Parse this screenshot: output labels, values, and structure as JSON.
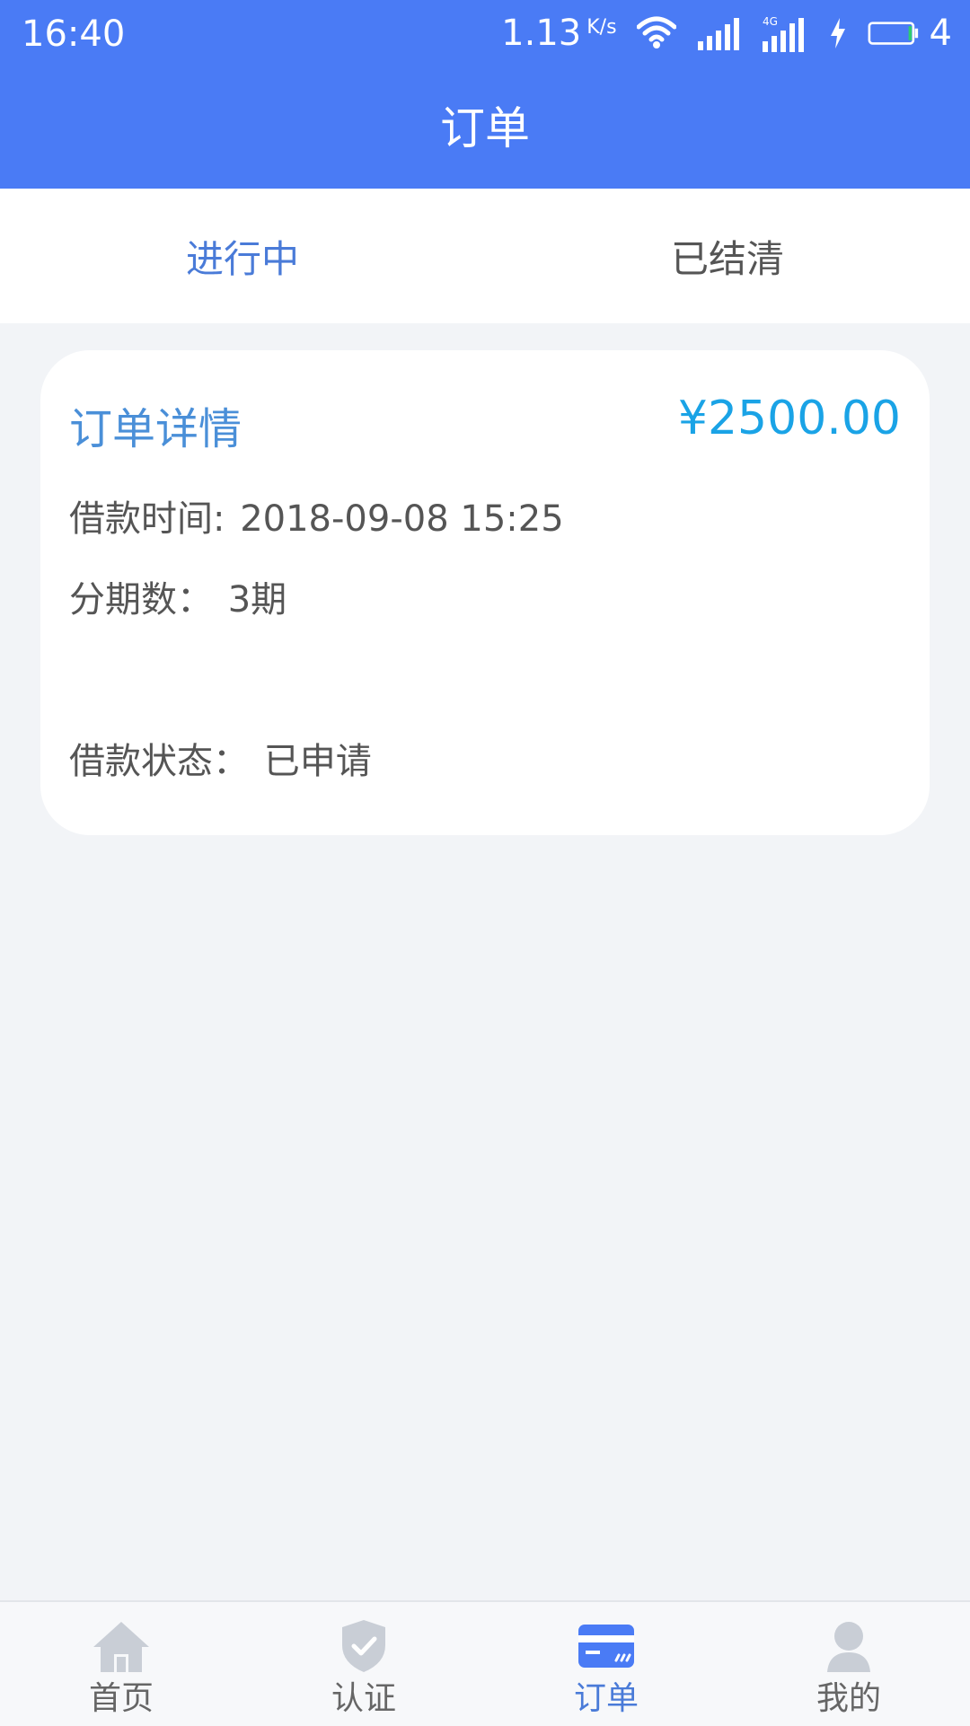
{
  "status_bar": {
    "time": "16:40",
    "speed": "1.13",
    "speed_unit": "K/s",
    "battery_text": "4"
  },
  "header": {
    "title": "订单"
  },
  "tabs": [
    {
      "label": "进行中",
      "active": true
    },
    {
      "label": "已结清",
      "active": false
    }
  ],
  "order_card": {
    "title": "订单详情",
    "amount": "¥2500.00",
    "borrow_time_label": "借款时间:",
    "borrow_time_value": "2018-09-08 15:25",
    "installments_label": "分期数：",
    "installments_value": "3期",
    "status_label": "借款状态：",
    "status_value": "已申请"
  },
  "bottom_nav": [
    {
      "label": "首页",
      "icon": "home-icon",
      "active": false
    },
    {
      "label": "认证",
      "icon": "shield-check-icon",
      "active": false
    },
    {
      "label": "订单",
      "icon": "card-icon",
      "active": true
    },
    {
      "label": "我的",
      "icon": "user-icon",
      "active": false
    }
  ],
  "colors": {
    "primary": "#4a7bf5",
    "active_tab": "#4a7bd8",
    "amount": "#1aa3e6",
    "page_bg": "#f2f4f7"
  }
}
